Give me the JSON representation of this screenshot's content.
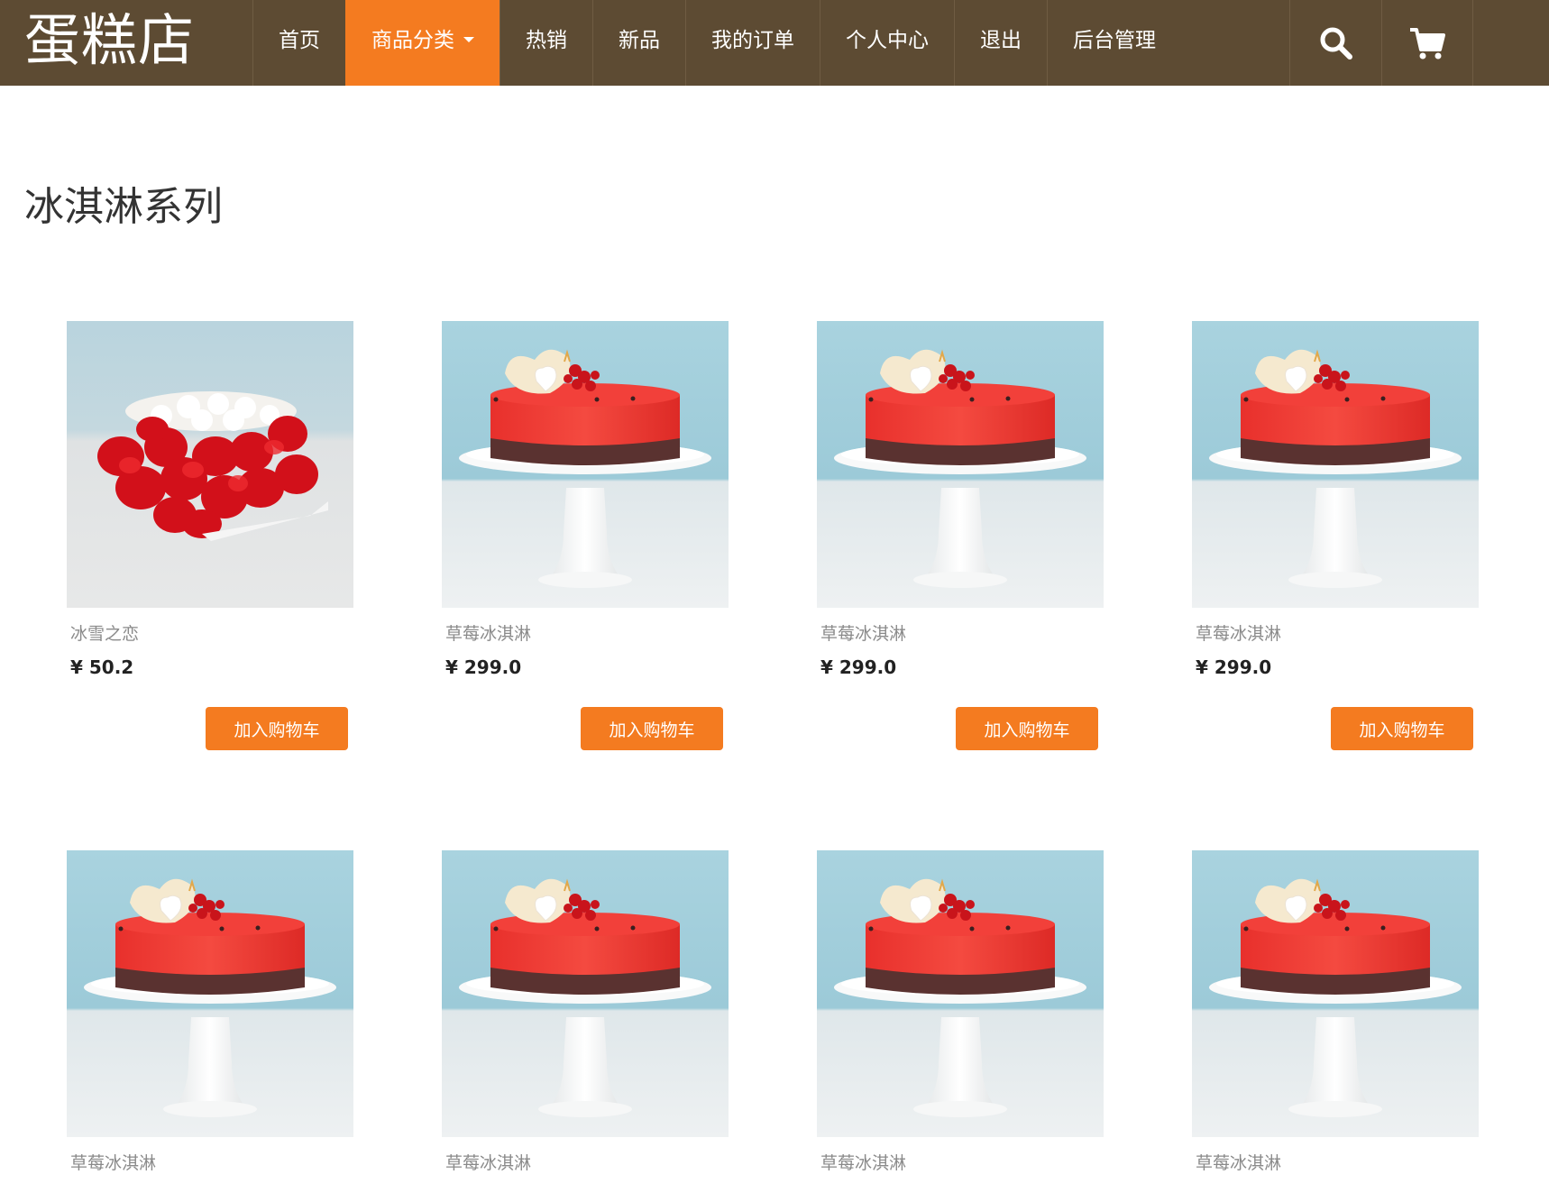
{
  "brand": "蛋糕店",
  "nav": {
    "items": [
      "首页",
      "商品分类",
      "热销",
      "新品",
      "我的订单",
      "个人中心",
      "退出",
      "后台管理"
    ],
    "active_item": "商品分类",
    "tools": [
      "search-icon",
      "cart-icon"
    ]
  },
  "colors": {
    "navbar": "#5d4b33",
    "accent": "#f47b20"
  },
  "section_title": "冰淇淋系列",
  "products": [
    {
      "name": "冰雪之恋",
      "price": "¥ 50.2",
      "button": "加入购物车",
      "image": "rose-petal-cake"
    },
    {
      "name": "草莓冰淇淋",
      "price": "¥ 299.0",
      "button": "加入购物车",
      "image": "strawberry-ice-cream-cake"
    },
    {
      "name": "草莓冰淇淋",
      "price": "¥ 299.0",
      "button": "加入购物车",
      "image": "strawberry-ice-cream-cake"
    },
    {
      "name": "草莓冰淇淋",
      "price": "¥ 299.0",
      "button": "加入购物车",
      "image": "strawberry-ice-cream-cake"
    },
    {
      "name": "草莓冰淇淋",
      "image": "strawberry-ice-cream-cake"
    },
    {
      "name": "草莓冰淇淋",
      "image": "strawberry-ice-cream-cake"
    },
    {
      "name": "草莓冰淇淋",
      "image": "strawberry-ice-cream-cake"
    },
    {
      "name": "草莓冰淇淋",
      "image": "strawberry-ice-cream-cake"
    }
  ]
}
